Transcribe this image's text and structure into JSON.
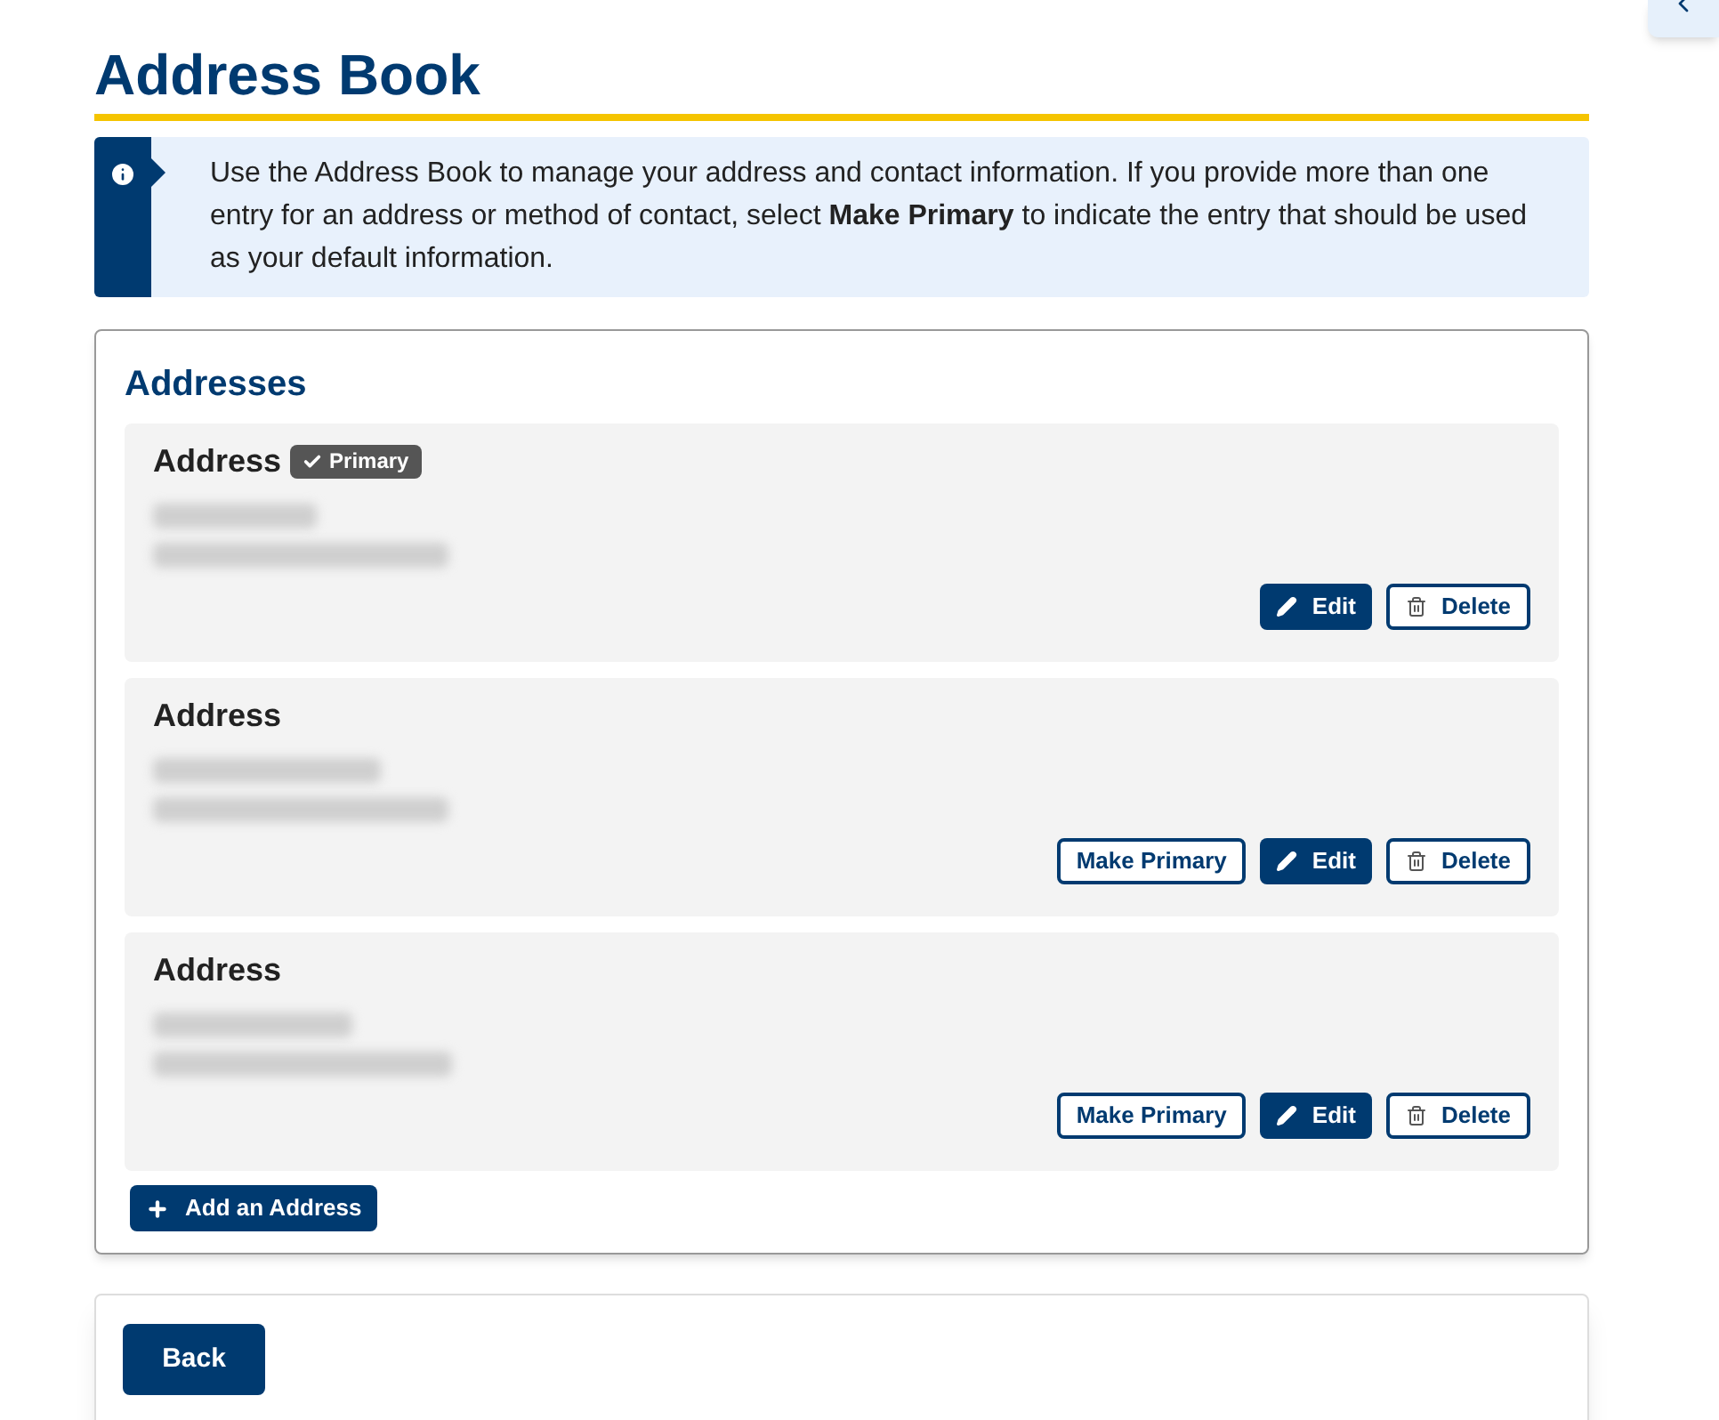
{
  "page_title": "Address Book",
  "info": {
    "text": "Use the Address Book to manage your address and contact information. If you provide more than one entry for an address or method of contact, select **Make Primary** to indicate the entry that should be used as your default information."
  },
  "addresses_section": {
    "heading": "Addresses",
    "entries": [
      {
        "title": "Address",
        "primary": true,
        "primary_label": "Primary",
        "buttons": [
          "Edit",
          "Delete"
        ]
      },
      {
        "title": "Address",
        "primary": false,
        "buttons": [
          "Make Primary",
          "Edit",
          "Delete"
        ]
      },
      {
        "title": "Address",
        "primary": false,
        "buttons": [
          "Make Primary",
          "Edit",
          "Delete"
        ]
      }
    ],
    "add_button": "Add an Address"
  },
  "back_button": "Back"
}
